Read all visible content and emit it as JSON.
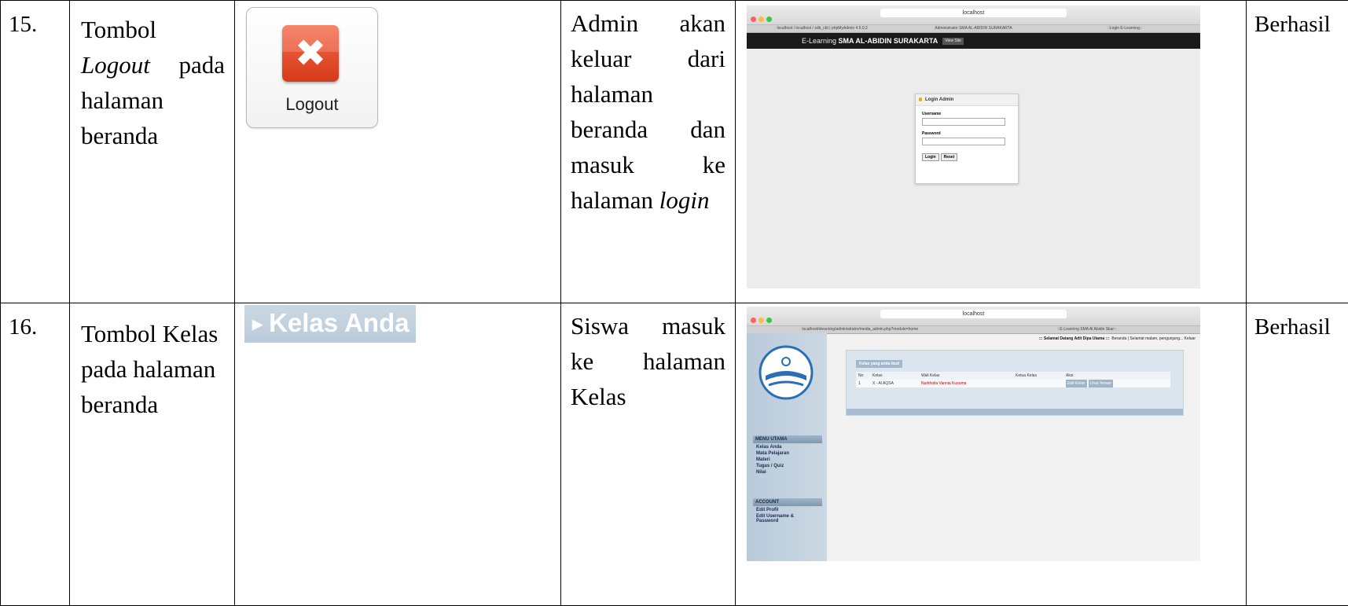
{
  "rows": [
    {
      "no": "15.",
      "item_lines": [
        {
          "text": "Tombol",
          "italic": false
        },
        {
          "text": "Logout",
          "italic": true,
          "suffix": "pada"
        },
        {
          "text": "halaman",
          "italic": false
        },
        {
          "text": "beranda",
          "italic": false
        }
      ],
      "widget": {
        "label": "Logout"
      },
      "desc_lines": [
        {
          "w1": "Admin",
          "w2": "akan"
        },
        {
          "w1": "keluar",
          "w2": "dari"
        },
        {
          "w1": "halaman",
          "w2": ""
        },
        {
          "w1": "beranda",
          "w2": "dan"
        },
        {
          "w1": "masuk",
          "w2": "ke"
        },
        {
          "w1": "halaman",
          "w2": "login"
        }
      ],
      "screenshot": {
        "url": "localhost",
        "tabs": [
          "localhost / localhost / sdb_cbt | phpMyAdmin 4.5.0.2",
          "Administrator SMA AL-ABIDIN SURAKARTA",
          "::Login E-Learning::"
        ],
        "header_prefix": "E-Learning",
        "header_bold": "SMA AL-ABIDIN SURAKARTA",
        "view_site": "View Site",
        "login_title": "Login Admin",
        "username_label": "Username",
        "password_label": "Password",
        "login_btn": "Login",
        "reset_btn": "Reset"
      },
      "result": "Berhasil"
    },
    {
      "no": "16.",
      "item_lines": [
        {
          "text": "Tombol Kelas"
        },
        {
          "text": "pada halaman"
        },
        {
          "text": "beranda"
        }
      ],
      "widget": {
        "label": "Kelas Anda"
      },
      "desc_lines": [
        {
          "w1": "Siswa",
          "w2": "masuk"
        },
        {
          "w1": "ke",
          "w2": "halaman"
        },
        {
          "w1": "Kelas",
          "w2": ""
        }
      ],
      "screenshot": {
        "url": "localhost",
        "tabs": [
          "localhost/elearning/administrator/media_admin.php?module=home",
          "::E-Learning SMA Al Abidin Skar::"
        ],
        "welcome_bold": "::: Selamat Datang Adit Dipa Utama :::",
        "welcome_rest": "Beranda | Selamat malam, pengunjung...   Keluar",
        "menu_utama": "MENU UTAMA",
        "menu_items": [
          "Kelas Anda",
          "Mata Pelajaran",
          "Materi",
          "Tugas / Quiz",
          "Nilai"
        ],
        "account": "ACCOUNT",
        "account_items": [
          "Edit Profil",
          "Edit Username &",
          "Password"
        ],
        "panel_title": "Kelas yang anda ikuti",
        "headers": [
          "No",
          "Kelas",
          "Wali Kelas",
          "Ketua Kelas",
          "Aksi"
        ],
        "row": [
          "1",
          "X - Al AQSA",
          "Nurkhoila Vannia Kusuma",
          ""
        ],
        "btn_edit": "Edit Kelas",
        "btn_lihat": "Lihat Teman"
      },
      "result": "Berhasil"
    }
  ]
}
